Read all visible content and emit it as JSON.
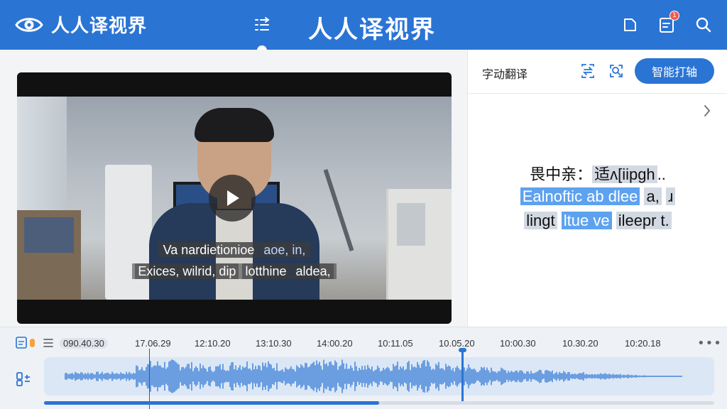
{
  "app": {
    "name": "人人译视界",
    "title": "人人译视界"
  },
  "header": {
    "notification_count": "1"
  },
  "video": {
    "subtitle_line1_a": "Va nardietionioe",
    "subtitle_line1_b": "aoe, in,",
    "subtitle_line2_a": "Exices, wilrid, dip",
    "subtitle_line2_b": "lotthine",
    "subtitle_line2_c": "aldea,"
  },
  "translate_panel": {
    "title": "字动翻译",
    "smart_button": "智能打轴",
    "line1_a": "畏中亲：",
    "line1_b": "适ʌ[iipgh",
    "line1_c": "..",
    "line2_a": "Ealnoftic ab dlee",
    "line2_b": "a,",
    "line2_c": "ɹ",
    "line3_a": "lingt",
    "line3_b": "ltue ve",
    "line3_c": "ileepr",
    "line3_d": "t."
  },
  "timeline": {
    "ticks": [
      "090.40.30",
      "17.06.29",
      "12:10.20",
      "13:10.30",
      "14:00.20",
      "10:11.05",
      "10.05.20",
      "10:00.30",
      "10.30.20",
      "10:20.18"
    ],
    "playhead_label": "10.05.20",
    "more": "•••",
    "scroll_progress": 0.5
  },
  "colors": {
    "brand": "#2a74d4",
    "waveform": "#3a7fd8",
    "highlight": "#5da2ef"
  }
}
